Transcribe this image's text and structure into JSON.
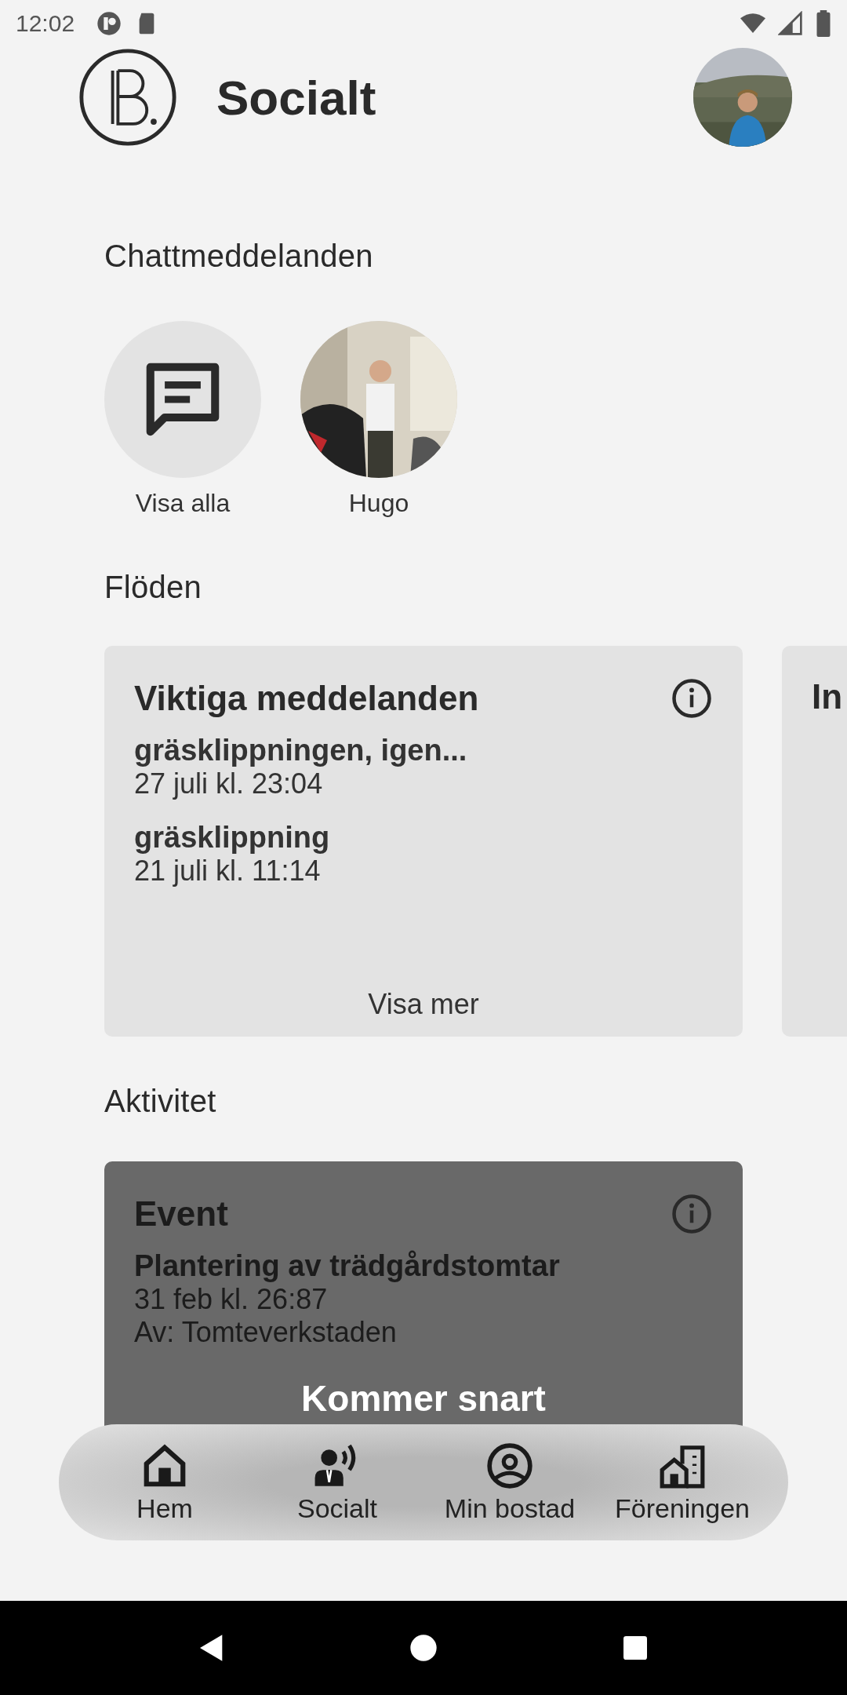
{
  "status_bar": {
    "time": "12:02"
  },
  "header": {
    "title": "Socialt"
  },
  "chats": {
    "heading": "Chattmeddelanden",
    "items": [
      {
        "kind": "all",
        "label": "Visa alla"
      },
      {
        "kind": "contact",
        "label": "Hugo"
      }
    ]
  },
  "feeds": {
    "heading": "Flöden",
    "cards": [
      {
        "title": "Viktiga meddelanden",
        "items": [
          {
            "title": "gräsklippningen, igen...",
            "date": "27 juli kl. 23:04"
          },
          {
            "title": "gräsklippning",
            "date": "21 juli kl. 11:14"
          }
        ],
        "more": "Visa mer"
      },
      {
        "title": "In"
      }
    ]
  },
  "activity": {
    "heading": "Aktivitet",
    "card": {
      "title": "Event",
      "item": {
        "title": "Plantering av trädgårdstomtar",
        "date": "31 feb kl. 26:87",
        "by": "Av: Tomteverkstaden"
      },
      "overlay": "Kommer snart"
    }
  },
  "nav": [
    {
      "label": "Hem"
    },
    {
      "label": "Socialt"
    },
    {
      "label": "Min bostad"
    },
    {
      "label": "Föreningen"
    }
  ]
}
